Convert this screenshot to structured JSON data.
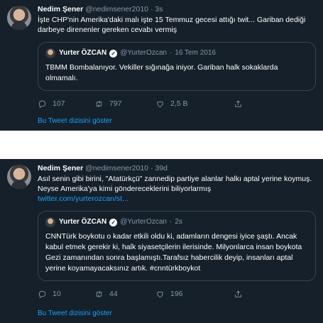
{
  "tweets": [
    {
      "author_name": "Nedim Şener",
      "author_handle": "@nedimsener2010",
      "dot": "·",
      "time": "3s",
      "text": "İşte CHP'nin Amerika'daki malı işte 15 Temmuz gecesi attığı twit... Gariban dediği darbeye direnenler gereken cevabı vermiş",
      "link": "",
      "quote": {
        "author_name": "Yurter ÖZCAN",
        "author_handle": "@YurterOzcan",
        "dot": "·",
        "time": "16 Tem 2016",
        "text": "TBMM Bombalanıyor. Vekiller sığınağa iniyor. Gariban halk sokaklarda olmamalı."
      },
      "replies": "107",
      "retweets": "797",
      "likes": "2,5 B",
      "thread_link": "Bu Tweet dizisini göster"
    },
    {
      "author_name": "Nedim Şener",
      "author_handle": "@nedimsener2010",
      "dot": "·",
      "time": "39d",
      "text": "Asıl senin gibi birini, \"Atatürkçü\" zannedip partiye alanlar halkı aptal yerine koymuş. Neyse Amerika'ya kimi göndereceklerini biliyorlarmış",
      "link": "twitter.com/yurterozcan/st...",
      "quote": {
        "author_name": "Yurter ÖZCAN",
        "author_handle": "@YurterOzcan",
        "dot": "·",
        "time": "2s",
        "text": "CNNTürk boykotu o kadar etkili oldu ki, adamların dengesi iyice şaştı. Ancak kabul etmek gerekir ki, halk siyasetçilerin ilerisinde. Milyonlarca insan boykota Gezi zamanından sonra başlamıştı.Tarafsız habercilik deyip, insanları aptal yerine koyamayacaksınız artık. #cnntürkboykot"
      },
      "replies": "10",
      "retweets": "44",
      "likes": "196",
      "thread_link": "Bu Tweet dizisini göster"
    }
  ],
  "icons": {
    "reply": "reply-icon",
    "retweet": "retweet-icon",
    "like": "heart-icon",
    "share": "share-icon",
    "verified": "verified-badge-icon"
  },
  "colors": {
    "background": "#15202b",
    "text": "#ffffff",
    "secondary": "#8899a6",
    "link": "#1da1f2",
    "border": "#38444d"
  }
}
